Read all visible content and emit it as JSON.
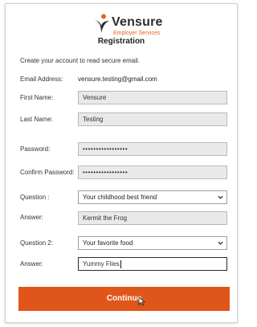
{
  "brand": {
    "name": "Vensure",
    "tagline": "Employer Services"
  },
  "page": {
    "title": "Registration",
    "intro": "Create your account to read secure email."
  },
  "form": {
    "email": {
      "label": "Email Address:",
      "value": "vensure.testing@gmail.com"
    },
    "first_name": {
      "label": "First Name:",
      "value": "Vensure"
    },
    "last_name": {
      "label": "Last Name:",
      "value": "Testing"
    },
    "password": {
      "label": "Password:",
      "value": "•••••••••••••••••"
    },
    "confirm_password": {
      "label": "Confirm Password:",
      "value": "•••••••••••••••••"
    },
    "question1": {
      "label": "Question :",
      "value": "Your childhood best friend"
    },
    "answer1": {
      "label": "Answer:",
      "value": "Kermit the Frog"
    },
    "question2": {
      "label": "Question 2:",
      "value": "Your favorite food"
    },
    "answer2": {
      "label": "Answer:",
      "value": "Yummy Flies"
    }
  },
  "actions": {
    "continue_label": "Continue"
  },
  "colors": {
    "accent": "#e0561a",
    "field_bg": "#e9e9e9"
  },
  "icons": {
    "logo": "vensure-swoosh-icon",
    "select": "chevron-down-icon",
    "pointer": "mouse-pointer-icon"
  }
}
